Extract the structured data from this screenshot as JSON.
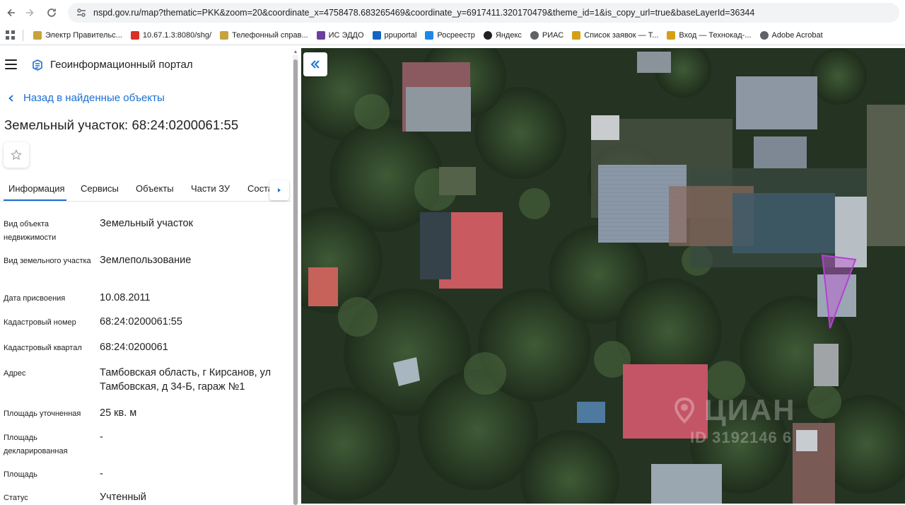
{
  "browser": {
    "url": "nspd.gov.ru/map?thematic=PKK&zoom=20&coordinate_x=4758478.683265469&coordinate_y=6917411.320170479&theme_id=1&is_copy_url=true&baseLayerId=36344",
    "bookmarks": [
      {
        "label": "Электр Правительс...",
        "icon": "emblem-icon",
        "color": "#c8a23c"
      },
      {
        "label": "10.67.1.3:8080/shg/",
        "icon": "red-squares-icon",
        "color": "#d93025"
      },
      {
        "label": "Телефонный справ...",
        "icon": "emblem-icon",
        "color": "#c8a23c"
      },
      {
        "label": "ИС ЭДДО",
        "icon": "edo-icon",
        "color": "#6b3fa0"
      },
      {
        "label": "ppuportal",
        "icon": "diamond-icon",
        "color": "#1565c0"
      },
      {
        "label": "Росреестр",
        "icon": "rosreestr-icon",
        "color": "#1e88e5"
      },
      {
        "label": "Яндекс",
        "icon": "plus-circle-icon",
        "color": "#202124"
      },
      {
        "label": "РИАС",
        "icon": "globe-icon",
        "color": "#5f6368"
      },
      {
        "label": "Список заявок — Т...",
        "icon": "m-icon",
        "color": "#d4a017"
      },
      {
        "label": "Вход — Технокад-...",
        "icon": "m-icon",
        "color": "#d4a017"
      },
      {
        "label": "Adobe Acrobat",
        "icon": "globe-icon",
        "color": "#5f6368"
      }
    ]
  },
  "portal": {
    "title": "Геоинформационный портал",
    "back_label": "Назад в найденные объекты",
    "object_title": "Земельный участок: 68:24:0200061:55",
    "tabs": [
      "Информация",
      "Сервисы",
      "Объекты",
      "Части ЗУ",
      "Соста"
    ],
    "active_tab": "Информация",
    "info": [
      {
        "label": "Вид объекта недвижимости",
        "value": "Земельный участок"
      },
      {
        "label": "Вид земельного участка",
        "value": "Землепользование"
      },
      {
        "label": "Дата присвоения",
        "value": "10.08.2011"
      },
      {
        "label": "Кадастровый номер",
        "value": "68:24:0200061:55"
      },
      {
        "label": "Кадастровый квартал",
        "value": "68:24:0200061"
      },
      {
        "label": "Адрес",
        "value": "Тамбовская область, г Кирсанов, ул Тамбовская, д 34-Б, гараж №1"
      },
      {
        "label": "Площадь уточненная",
        "value": "25 кв. м"
      },
      {
        "label": "Площадь декларированная",
        "value": "-"
      },
      {
        "label": "Площадь",
        "value": "-"
      },
      {
        "label": "Статус",
        "value": "Учтенный"
      }
    ]
  },
  "map": {
    "watermark_brand": "ЦИАН",
    "watermark_id": "ID 3192146 6",
    "parcel_outline_color": "#b53fd6",
    "accent": "#1a6fd3"
  }
}
